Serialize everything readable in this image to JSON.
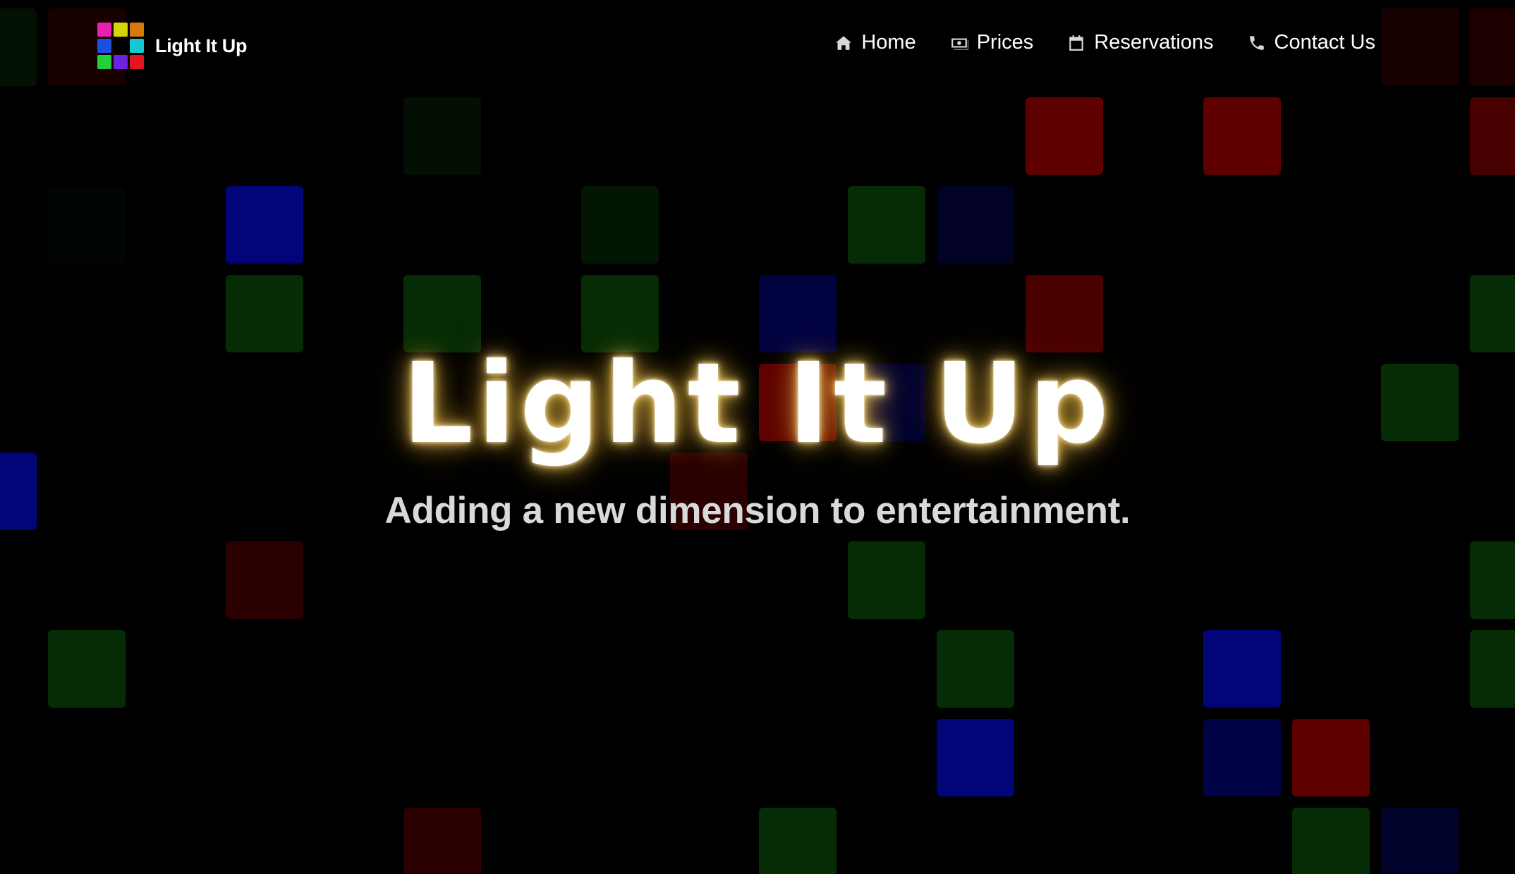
{
  "brand": {
    "name": "Light It Up",
    "logo_colors": [
      "#e81fb0",
      "#d4d40b",
      "#d47a0b",
      "#1a4fe0",
      "#000000",
      "#15c9d2",
      "#22d03a",
      "#6c22e6",
      "#e6141e"
    ]
  },
  "nav": {
    "items": [
      {
        "label": "Home",
        "icon": "home-icon"
      },
      {
        "label": "Prices",
        "icon": "money-icon"
      },
      {
        "label": "Reservations",
        "icon": "calendar-icon"
      },
      {
        "label": "Contact Us",
        "icon": "phone-icon"
      }
    ]
  },
  "hero": {
    "title": "Light It Up",
    "subtitle": "Adding a new dimension to entertainment."
  },
  "colors": {
    "background": "#000000",
    "tile_red": "#5e0000",
    "tile_green": "#062c06",
    "tile_blue": "#020577",
    "title_glow": "#f0c860"
  }
}
